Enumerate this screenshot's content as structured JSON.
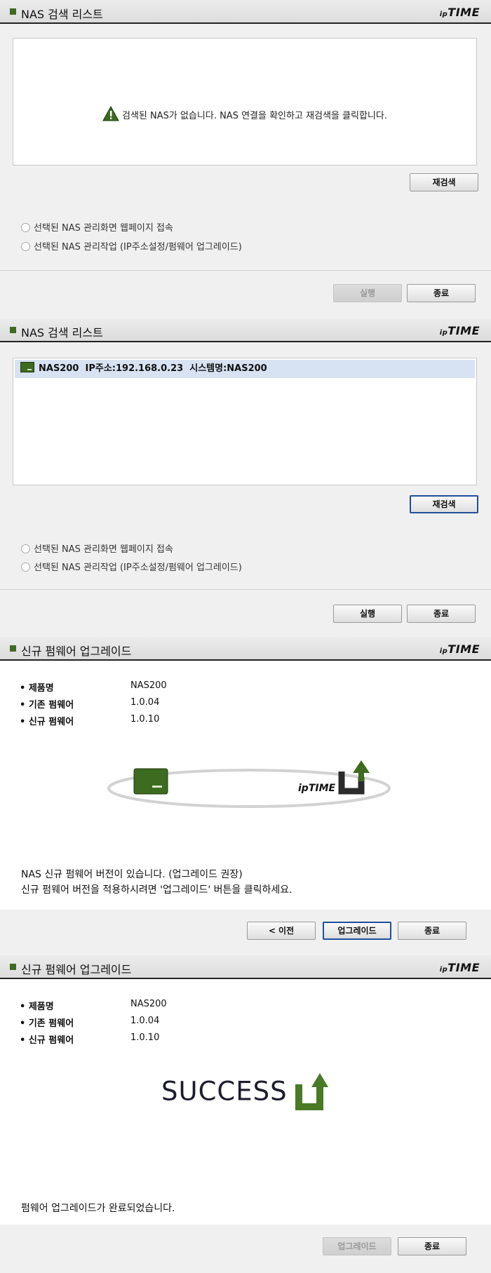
{
  "brand": {
    "logo_small": "ip",
    "logo_main": "TIME"
  },
  "panel1": {
    "title": "NAS 검색 리스트",
    "message": "검색된 NAS가 없습니다. NAS 연결을 확인하고 재검색을 클릭합니다.",
    "rescan": "재검색",
    "option1": "선택된 NAS 관리화면 웹페이지 접속",
    "option2": "선택된 NAS 관리작업 (IP주소설정/펌웨어 업그레이드)",
    "run": "실행",
    "close": "종료"
  },
  "panel2": {
    "title": "NAS 검색 리스트",
    "row": "NAS200  IP주소:192.168.0.23  시스템명:NAS200",
    "rescan": "재검색",
    "option1": "선택된 NAS 관리화면 웹페이지 접속",
    "option2": "선택된 NAS 관리작업 (IP주소설정/펌웨어 업그레이드)",
    "run": "실행",
    "close": "종료"
  },
  "panel3": {
    "title": "신규 펌웨어 업그레이드",
    "info": [
      {
        "label": "• 제품명",
        "value": "NAS200"
      },
      {
        "label": "• 기존 펌웨어",
        "value": "1.0.04"
      },
      {
        "label": "• 신규 펌웨어",
        "value": "1.0.10"
      }
    ],
    "line1": "NAS 신규 펌웨어 버전이 있습니다. (업그레이드 권장)",
    "line2": "신규 펌웨어 버전을 적용하시려면 '업그레이드' 버튼을 클릭하세요.",
    "prev": "< 이전",
    "upgrade": "업그레이드",
    "close": "종료"
  },
  "panel4": {
    "title": "신규 펌웨어 업그레이드",
    "info": [
      {
        "label": "• 제품명",
        "value": "NAS200"
      },
      {
        "label": "• 기존 펌웨어",
        "value": "1.0.04"
      },
      {
        "label": "• 신규 펌웨어",
        "value": "1.0.10"
      }
    ],
    "success": "SUCCESS",
    "done": "펌웨어 업그레이드가 완료되었습니다.",
    "upgrade": "업그레이드",
    "close": "종료"
  },
  "colors": {
    "accent": "#3d6b1f",
    "focus": "#1f4f9a",
    "selection": "#d7e2f2"
  }
}
